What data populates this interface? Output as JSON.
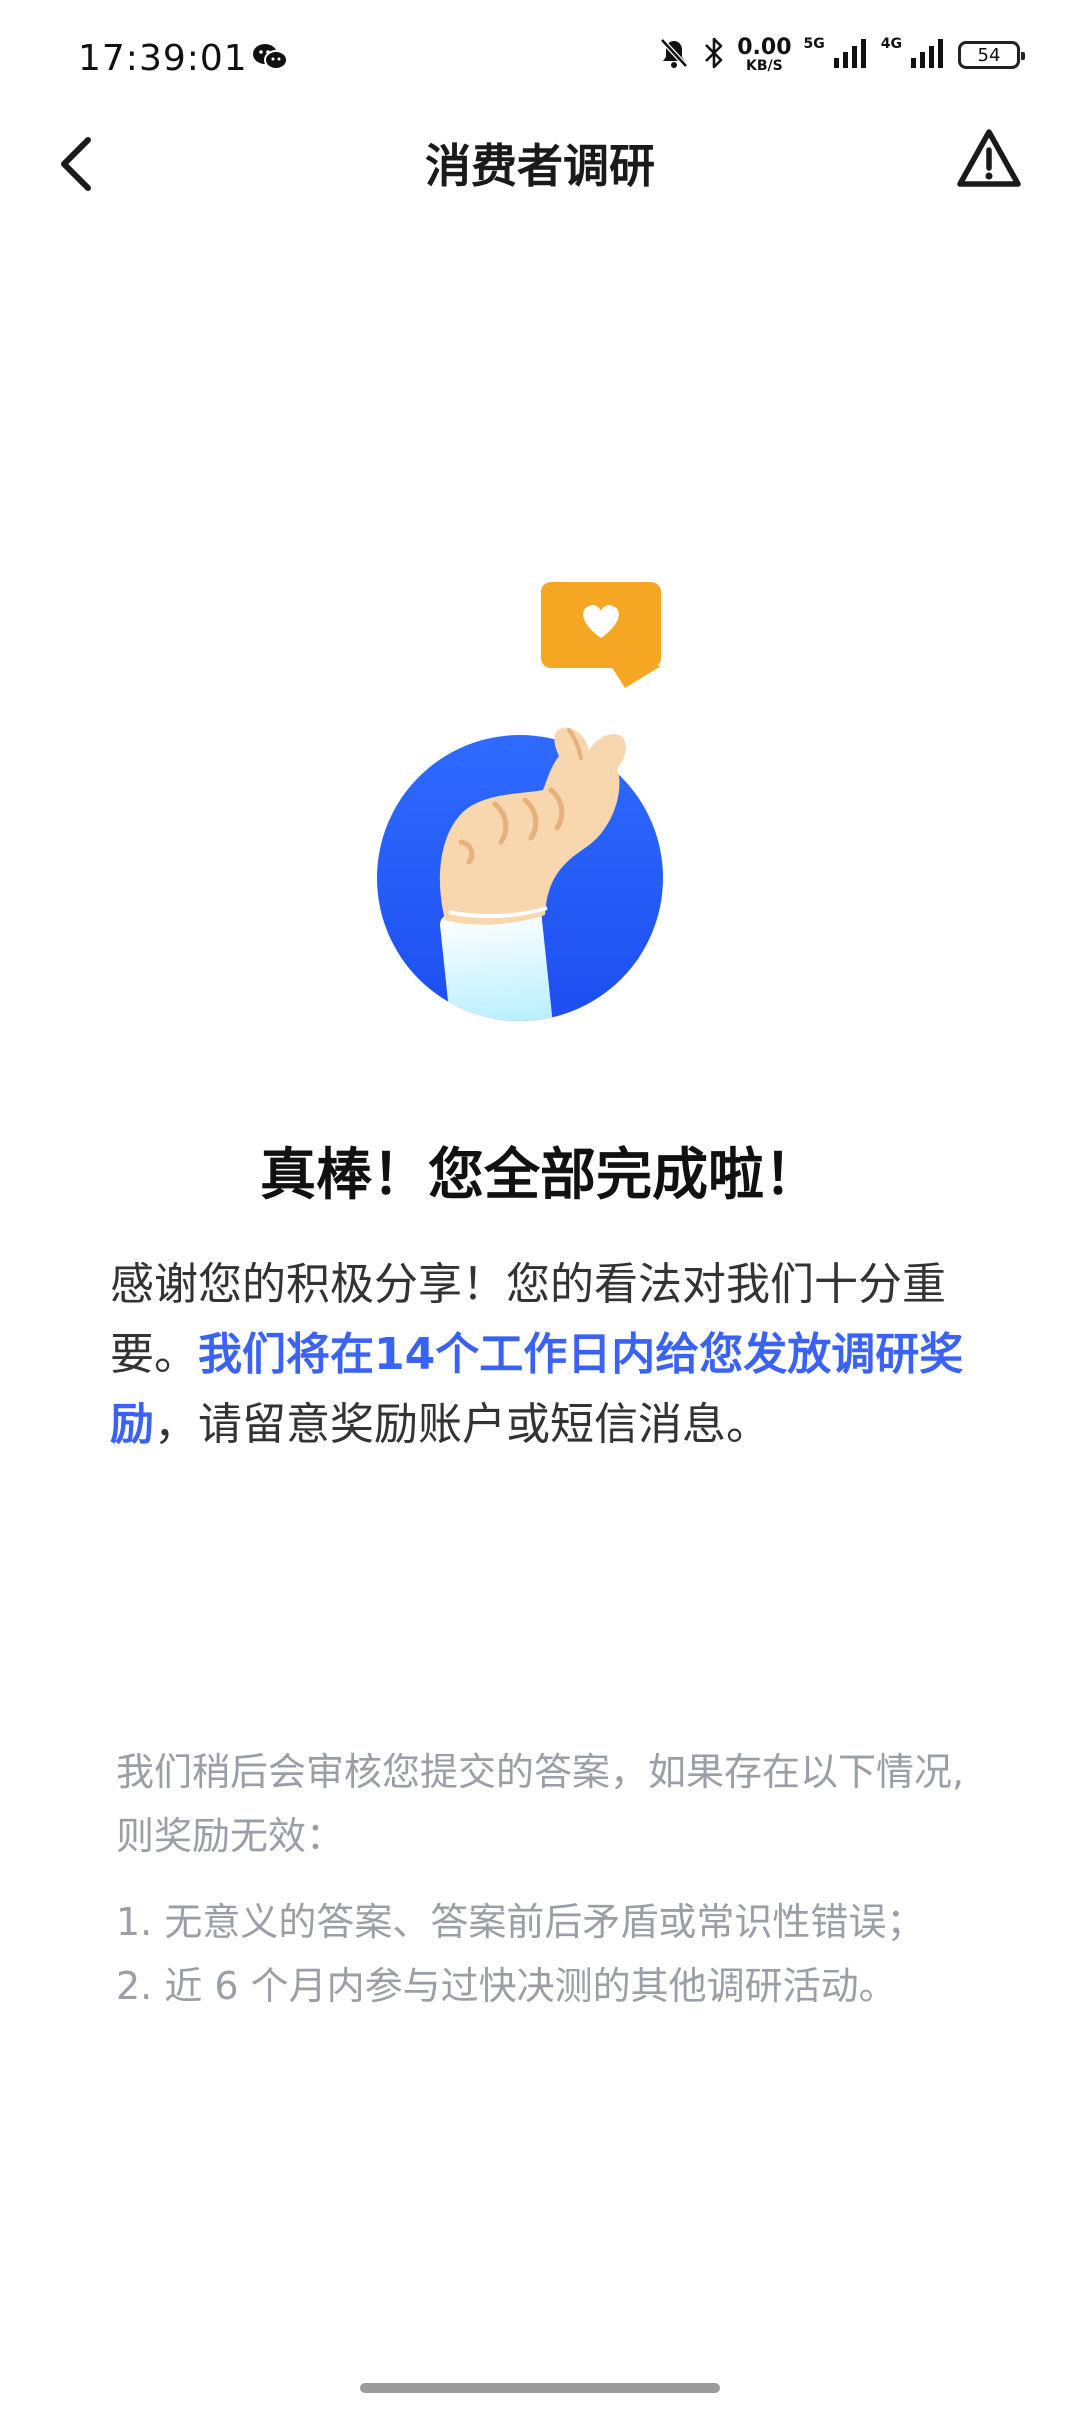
{
  "status_bar": {
    "time": "17:39:01",
    "net_speed_value": "0.00",
    "net_speed_unit": "KB/S",
    "signal1_label": "5G",
    "signal2_label": "4G",
    "battery": "54"
  },
  "header": {
    "title": "消费者调研"
  },
  "main": {
    "headline": "真棒！您全部完成啦！",
    "message_part1": "感谢您的积极分享！您的看法对我们十分重要。",
    "message_highlight": "我们将在14个工作日内给您发放调研奖励",
    "message_part2": "，请留意奖励账户或短信消息。"
  },
  "notice": {
    "intro": "我们稍后会审核您提交的答案，如果存在以下情况,则奖励无效：",
    "rules": [
      "1. 无意义的答案、答案前后矛盾或常识性错误；",
      "2. 近 6 个月内参与过快决测的其他调研活动。"
    ]
  },
  "colors": {
    "accent": "#3a63f5",
    "bubble": "#f5a623",
    "muted_text": "#9a9ea6"
  },
  "icons": [
    "back-arrow-icon",
    "warning-triangle-icon",
    "wechat-icon",
    "bell-muted-icon",
    "bluetooth-icon",
    "signal-icon",
    "battery-icon",
    "heart-icon"
  ]
}
